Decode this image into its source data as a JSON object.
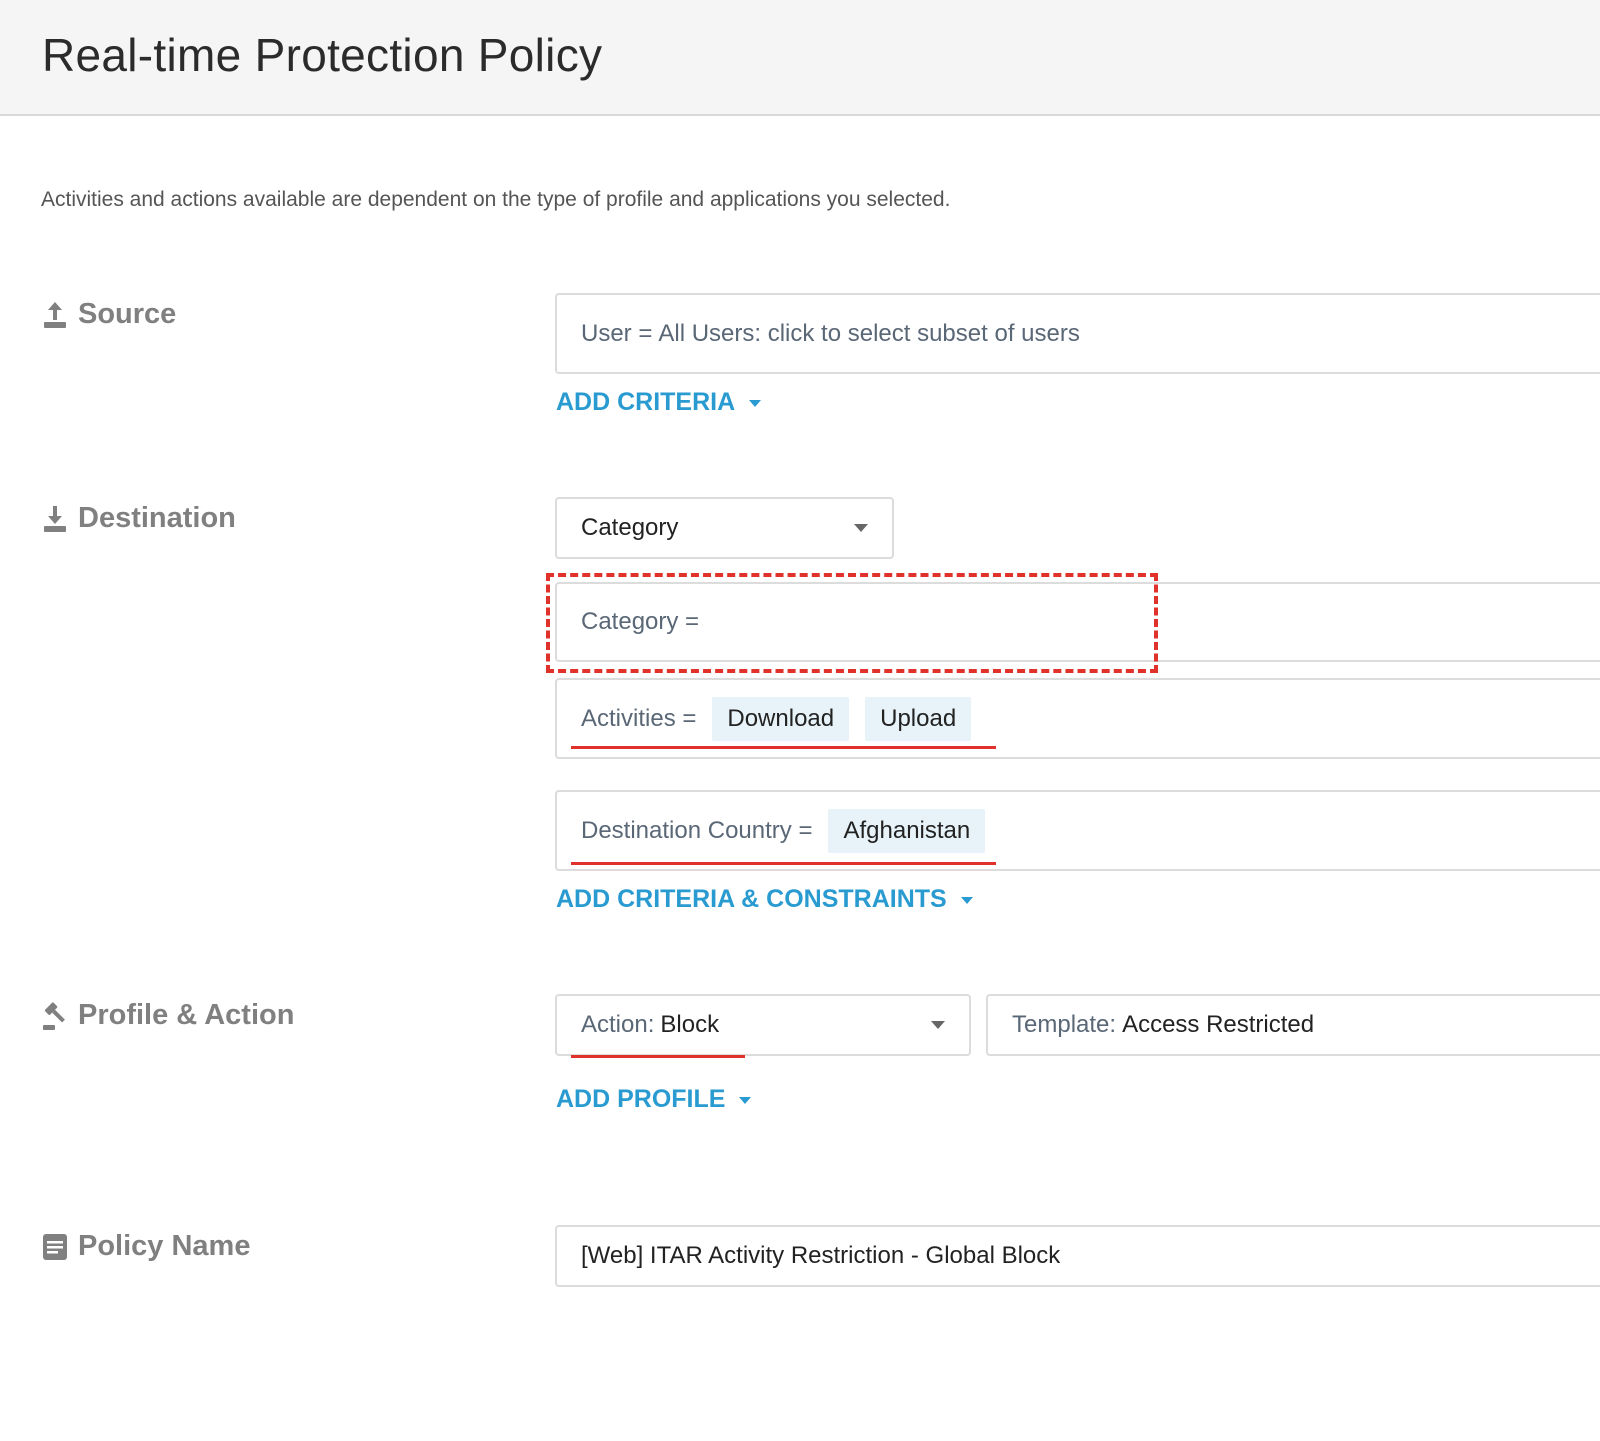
{
  "header": {
    "title": "Real-time Protection Policy"
  },
  "subtitle": "Activities and actions available are dependent on the type of profile and applications you selected.",
  "source": {
    "label": "Source",
    "icon": "upload-icon",
    "user_criteria": {
      "key": "User = ",
      "value": "All Users: click to select subset of users"
    },
    "add_link": "ADD CRITERIA"
  },
  "destination": {
    "label": "Destination",
    "icon": "download-icon",
    "type_select": "Category",
    "category_criteria": {
      "key": "Category ="
    },
    "activities": {
      "key": "Activities =",
      "chips": [
        "Download",
        "Upload"
      ]
    },
    "country": {
      "key": "Destination Country =",
      "chips": [
        "Afghanistan"
      ]
    },
    "add_link": "ADD CRITERIA & CONSTRAINTS"
  },
  "profile": {
    "label": "Profile & Action",
    "icon": "gavel-icon",
    "action": {
      "key": "Action: ",
      "value": "Block"
    },
    "template": {
      "key": "Template: ",
      "value": "Access Restricted"
    },
    "add_link": "ADD PROFILE"
  },
  "policy": {
    "label": "Policy Name",
    "icon": "document-icon",
    "name": "[Web] ITAR Activity Restriction - Global Block"
  },
  "colors": {
    "accent": "#2a9bd1",
    "highlight": "#e0312a",
    "chip_bg": "#e7f3f8",
    "label_gray": "#808080"
  }
}
